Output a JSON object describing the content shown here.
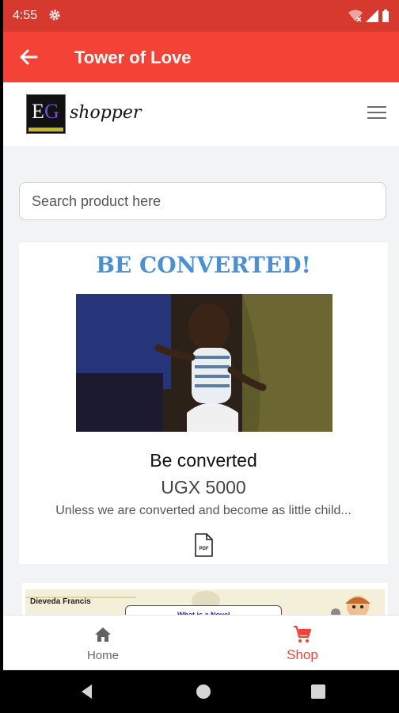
{
  "status_bar": {
    "time": "4:55"
  },
  "app_bar": {
    "title": "Tower of Love"
  },
  "site_header": {
    "logo_initials_e": "E",
    "logo_initials_g": "G",
    "logo_word": "shopper"
  },
  "search": {
    "placeholder": "Search product here",
    "value": ""
  },
  "product": {
    "banner": "BE CONVERTED!",
    "name": "Be converted",
    "price": "UGX 5000",
    "description": "Unless we are converted and become as little child..."
  },
  "next_product": {
    "author": "Dieveda Francis",
    "pill_text": "What is a Novel"
  },
  "bottom_nav": {
    "items": [
      {
        "label": "Home"
      },
      {
        "label": "Shop"
      }
    ]
  },
  "colors": {
    "primary": "#f44336",
    "status_bar": "#d63a2f",
    "banner_blue": "#4a90d6"
  }
}
